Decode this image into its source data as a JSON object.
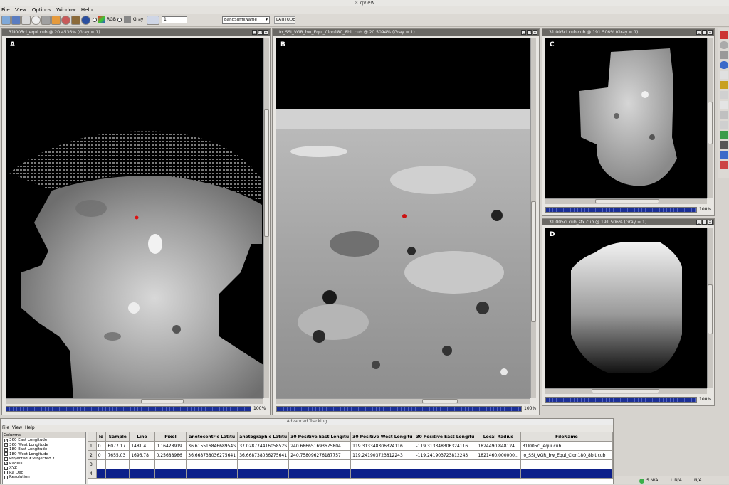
{
  "app": {
    "title": "qview"
  },
  "menu": [
    "File",
    "View",
    "Options",
    "Window",
    "Help"
  ],
  "toolbar": {
    "rgb_label": "RGB",
    "gray_label": "Gray",
    "band_spin": "1",
    "band_combo": "BandSuffixName",
    "field_label": "LATITUDE"
  },
  "viewports": [
    {
      "title": "31I005ci_equi.cub @ 20.4536% (Gray = 1)",
      "label": "A",
      "zoom_pct": "100%"
    },
    {
      "title": "Io_SSI_VGR_bw_Equi_Clon180_8bit.cub @ 20.5094% (Gray = 1)",
      "label": "B",
      "zoom_pct": "100%"
    },
    {
      "title": "31I005ci.cub.cub @ 191.506% (Gray = 1)",
      "label": "C",
      "zoom_pct": "100%"
    },
    {
      "title": "31I005ci.cub_sfx.cub @ 191.506% (Gray = 1)",
      "label": "D",
      "zoom_pct": "100%"
    }
  ],
  "tracking": {
    "title": "Advanced Tracking",
    "menu": [
      "File",
      "View",
      "Help"
    ],
    "columns_title": "Columns",
    "column_options": [
      {
        "label": "360 East Longitude",
        "checked": true
      },
      {
        "label": "360 West Longitude",
        "checked": true
      },
      {
        "label": "180 East Longitude",
        "checked": true
      },
      {
        "label": "180 West Longitude",
        "checked": false
      },
      {
        "label": "Projected X:Projected Y",
        "checked": false
      },
      {
        "label": "Radius",
        "checked": true
      },
      {
        "label": "XYZ",
        "checked": false
      },
      {
        "label": "Ra Dec",
        "checked": false
      },
      {
        "label": "Resolution",
        "checked": false
      }
    ],
    "headers": [
      "Id",
      "Sample",
      "Line",
      "Pixel",
      "anetocentric Latitu",
      "anetographic Latitu",
      "30 Positive East Longitu",
      "30 Positive West Longitu",
      "30 Positive East Longitu",
      "Local Radius",
      "FileName"
    ],
    "rows": [
      {
        "num": "1",
        "cells": [
          "0",
          "6077.17",
          "1481.4",
          "0.16428919",
          "36.61551684668954S",
          "37.02877441605852S",
          "240.686651693675804",
          "119.313348306324116",
          "-119.313348306324116",
          "1824490.848124...",
          "31I005ci_equi.cub"
        ]
      },
      {
        "num": "2",
        "cells": [
          "0",
          "7655.03",
          "1696.78",
          "0.25688986",
          "36.668738036275641",
          "36.668738036275641",
          "240.758096276187757",
          "119.241903723812243",
          "-119.241903723812243",
          "1821460.000000...",
          "Io_SSI_VGR_bw_Equi_Clon180_8bit.cub"
        ]
      },
      {
        "num": "3",
        "cells": [
          "",
          "",
          "",
          "",
          "",
          "",
          "",
          "",
          "",
          "",
          ""
        ]
      },
      {
        "num": "4",
        "cells": [
          "",
          "",
          "",
          "",
          "",
          "",
          "",
          "",
          "",
          "",
          ""
        ]
      }
    ]
  },
  "status": {
    "s": "S N/A",
    "l": "L N/A",
    "v": "N/A"
  },
  "colors": {
    "titlebar": "#6b6965",
    "progress": "#1b2f95",
    "selected_row": "#0c1f8a"
  }
}
